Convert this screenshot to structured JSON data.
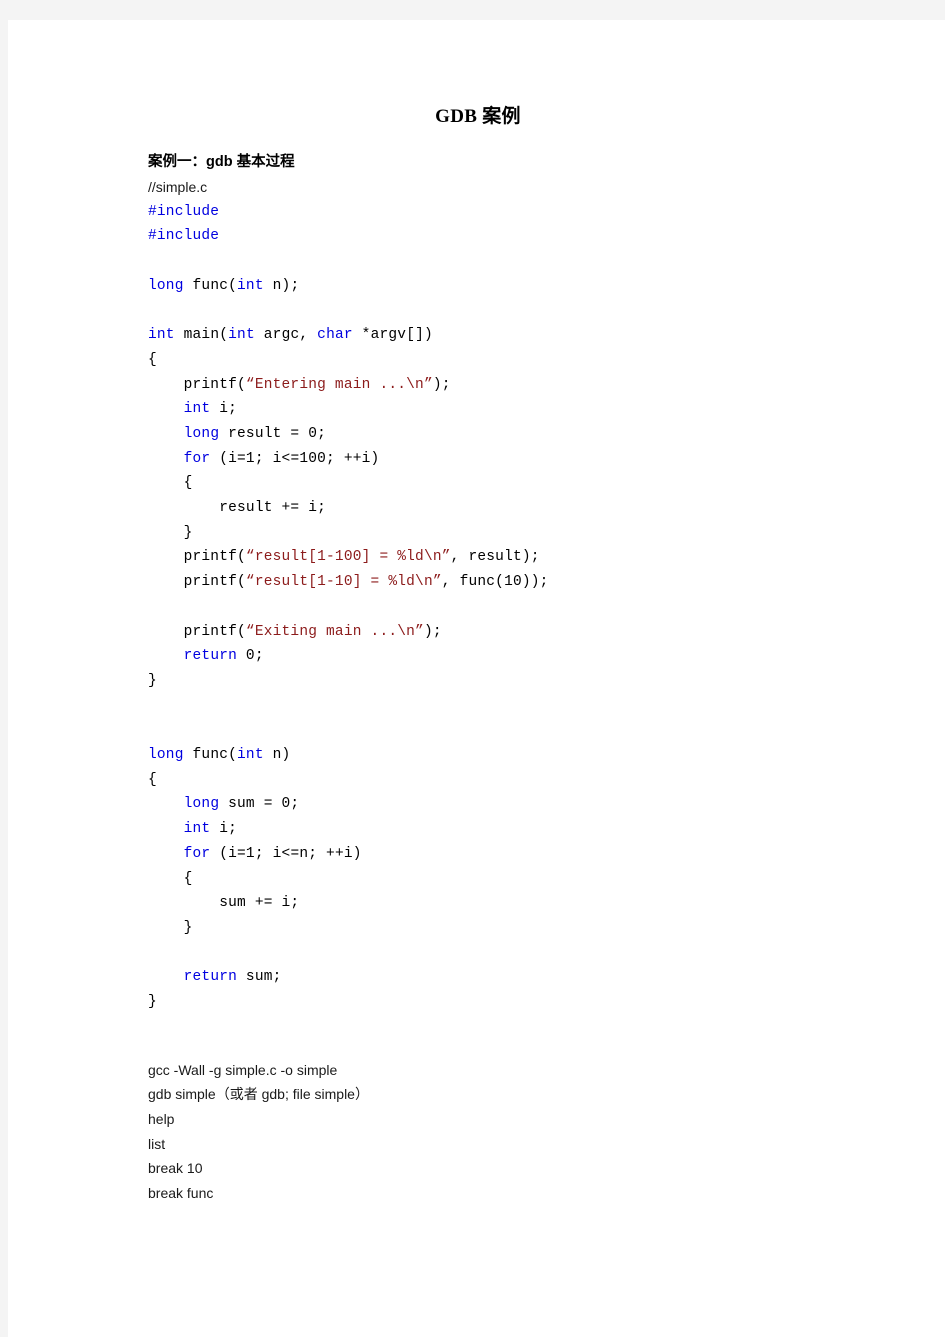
{
  "document": {
    "title": "GDB 案例",
    "section_heading": "案例一：gdb 基本过程",
    "comment_line": "//simple.c"
  },
  "colors": {
    "page_background": "#ffffff",
    "canvas_background": "#f4f4f4",
    "keyword": "#0000e0",
    "preprocessor": "#0000e0",
    "string": "#8c1b1b",
    "plain": "#000000",
    "body_text": "#1a1a1a"
  },
  "code": {
    "language": "c",
    "filename": "simple.c",
    "lines": [
      {
        "id": "inc1",
        "tokens": [
          {
            "t": "pre",
            "s": "#include"
          }
        ]
      },
      {
        "id": "inc2",
        "tokens": [
          {
            "t": "pre",
            "s": "#include"
          }
        ]
      },
      {
        "id": "b1",
        "tokens": []
      },
      {
        "id": "proto",
        "tokens": [
          {
            "t": "kw",
            "s": "long"
          },
          {
            "t": "pln",
            "s": " func("
          },
          {
            "t": "kw",
            "s": "int"
          },
          {
            "t": "pln",
            "s": " n);"
          }
        ]
      },
      {
        "id": "b2",
        "tokens": []
      },
      {
        "id": "mainsig",
        "tokens": [
          {
            "t": "kw",
            "s": "int"
          },
          {
            "t": "pln",
            "s": " main("
          },
          {
            "t": "kw",
            "s": "int"
          },
          {
            "t": "pln",
            "s": " argc, "
          },
          {
            "t": "kw",
            "s": "char"
          },
          {
            "t": "pln",
            "s": " *argv[])"
          }
        ]
      },
      {
        "id": "mainopen",
        "tokens": [
          {
            "t": "pln",
            "s": "{"
          }
        ]
      },
      {
        "id": "pr1",
        "tokens": [
          {
            "t": "pln",
            "s": "    printf("
          },
          {
            "t": "str",
            "s": "“Entering main ...\\n”"
          },
          {
            "t": "pln",
            "s": ");"
          }
        ]
      },
      {
        "id": "dec_i",
        "tokens": [
          {
            "t": "pln",
            "s": "    "
          },
          {
            "t": "kw",
            "s": "int"
          },
          {
            "t": "pln",
            "s": " i;"
          }
        ]
      },
      {
        "id": "dec_r",
        "tokens": [
          {
            "t": "pln",
            "s": "    "
          },
          {
            "t": "kw",
            "s": "long"
          },
          {
            "t": "pln",
            "s": " result = 0;"
          }
        ]
      },
      {
        "id": "for1",
        "tokens": [
          {
            "t": "pln",
            "s": "    "
          },
          {
            "t": "kw",
            "s": "for"
          },
          {
            "t": "pln",
            "s": " (i=1; i<=100; ++i)"
          }
        ]
      },
      {
        "id": "for1o",
        "tokens": [
          {
            "t": "pln",
            "s": "    {"
          }
        ]
      },
      {
        "id": "acc1",
        "tokens": [
          {
            "t": "pln",
            "s": "        result += i;"
          }
        ]
      },
      {
        "id": "for1c",
        "tokens": [
          {
            "t": "pln",
            "s": "    }"
          }
        ]
      },
      {
        "id": "pr2",
        "tokens": [
          {
            "t": "pln",
            "s": "    printf("
          },
          {
            "t": "str",
            "s": "“result[1-100] = %ld\\n”"
          },
          {
            "t": "pln",
            "s": ", result);"
          }
        ]
      },
      {
        "id": "pr3",
        "tokens": [
          {
            "t": "pln",
            "s": "    printf("
          },
          {
            "t": "str",
            "s": "“result[1-10] = %ld\\n”"
          },
          {
            "t": "pln",
            "s": ", func(10));"
          }
        ]
      },
      {
        "id": "b3",
        "tokens": []
      },
      {
        "id": "pr4",
        "tokens": [
          {
            "t": "pln",
            "s": "    printf("
          },
          {
            "t": "str",
            "s": "“Exiting main ...\\n”"
          },
          {
            "t": "pln",
            "s": ");"
          }
        ]
      },
      {
        "id": "ret0",
        "tokens": [
          {
            "t": "pln",
            "s": "    "
          },
          {
            "t": "kw",
            "s": "return"
          },
          {
            "t": "pln",
            "s": " 0;"
          }
        ]
      },
      {
        "id": "mainclose",
        "tokens": [
          {
            "t": "pln",
            "s": "}"
          }
        ]
      },
      {
        "id": "b4",
        "tokens": []
      },
      {
        "id": "b5",
        "tokens": []
      },
      {
        "id": "funcsig",
        "tokens": [
          {
            "t": "kw",
            "s": "long"
          },
          {
            "t": "pln",
            "s": " func("
          },
          {
            "t": "kw",
            "s": "int"
          },
          {
            "t": "pln",
            "s": " n)"
          }
        ]
      },
      {
        "id": "funcopen",
        "tokens": [
          {
            "t": "pln",
            "s": "{"
          }
        ]
      },
      {
        "id": "dec_s",
        "tokens": [
          {
            "t": "pln",
            "s": "    "
          },
          {
            "t": "kw",
            "s": "long"
          },
          {
            "t": "pln",
            "s": " sum = 0;"
          }
        ]
      },
      {
        "id": "dec_i2",
        "tokens": [
          {
            "t": "pln",
            "s": "    "
          },
          {
            "t": "kw",
            "s": "int"
          },
          {
            "t": "pln",
            "s": " i;"
          }
        ]
      },
      {
        "id": "for2",
        "tokens": [
          {
            "t": "pln",
            "s": "    "
          },
          {
            "t": "kw",
            "s": "for"
          },
          {
            "t": "pln",
            "s": " (i=1; i<=n; ++i)"
          }
        ]
      },
      {
        "id": "for2o",
        "tokens": [
          {
            "t": "pln",
            "s": "    {"
          }
        ]
      },
      {
        "id": "acc2",
        "tokens": [
          {
            "t": "pln",
            "s": "        sum += i;"
          }
        ]
      },
      {
        "id": "for2c",
        "tokens": [
          {
            "t": "pln",
            "s": "    }"
          }
        ]
      },
      {
        "id": "b6",
        "tokens": []
      },
      {
        "id": "retsum",
        "tokens": [
          {
            "t": "pln",
            "s": "    "
          },
          {
            "t": "kw",
            "s": "return"
          },
          {
            "t": "pln",
            "s": " sum;"
          }
        ]
      },
      {
        "id": "funcclose",
        "tokens": [
          {
            "t": "pln",
            "s": "}"
          }
        ]
      }
    ]
  },
  "commands": {
    "lines": [
      "gcc -Wall -g simple.c -o simple",
      "gdb simple（或者 gdb; file simple）",
      "help",
      "list",
      "break 10",
      "break func"
    ]
  }
}
